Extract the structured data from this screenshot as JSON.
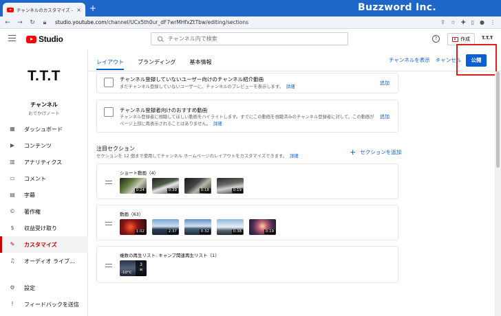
{
  "browser": {
    "tab_title": "チャンネルのカスタマイズ - YouTube S",
    "tab_close": "×",
    "new_tab": "+",
    "url_host": "studio.youtube.com",
    "url_path": "/channel/UCx5th0ur_dF7wrMHfxZtTbw/editing/sections",
    "brand_overlay": "Buzzword Inc."
  },
  "header": {
    "logo_text": "Studio",
    "search_placeholder": "チャンネル内で検索",
    "help_label": "?",
    "create_label": "作成",
    "avatar_label": "T.T.T"
  },
  "sidebar": {
    "channel_logo": "T.T.T",
    "channel_name": "チャンネル",
    "channel_sub": "おでかけノート",
    "items": [
      {
        "label": "ダッシュボード",
        "icon": "▦"
      },
      {
        "label": "コンテンツ",
        "icon": "▶"
      },
      {
        "label": "アナリティクス",
        "icon": "▥"
      },
      {
        "label": "コメント",
        "icon": "▭"
      },
      {
        "label": "字幕",
        "icon": "▤"
      },
      {
        "label": "著作権",
        "icon": "©"
      },
      {
        "label": "収益受け取り",
        "icon": "$"
      },
      {
        "label": "カスタマイズ",
        "icon": "✎"
      },
      {
        "label": "オーディオ ライブ...",
        "icon": "♫"
      }
    ],
    "bottom_items": [
      {
        "label": "設定",
        "icon": "⚙"
      },
      {
        "label": "フィードバックを送信",
        "icon": "!"
      }
    ]
  },
  "tabs": [
    {
      "label": "レイアウト"
    },
    {
      "label": "ブランディング"
    },
    {
      "label": "基本情報"
    }
  ],
  "actions": {
    "view_channel": "チャンネルを表示",
    "cancel": "キャンセル",
    "publish": "公開"
  },
  "cards": [
    {
      "title": "チャンネル登録していないユーザー向けのチャンネル紹介動画",
      "desc": "まだチャンネル登録していないユーザーに、チャンネルのプレビューを表示します。",
      "link": "詳細",
      "add": "追加"
    },
    {
      "title": "チャンネル登録者向けのおすすめ動画",
      "desc": "チャンネル登録者に視聴してほしい動画をハイライトします。すでにこの動画を視聴済みのチャンネル登録者に対して、この動画がページ上部に再表示されることはありません。",
      "link": "詳細",
      "add": "追加"
    }
  ],
  "featured": {
    "title": "注目セクション",
    "desc": "セクションを 12 個まで使用してチャンネル ホームページのレイアウトをカスタマイズできます。",
    "link": "詳細",
    "add_section": "セクションを追加"
  },
  "sections": [
    {
      "title": "ショート動画（4）",
      "thumbs": [
        "0:24",
        "0:39",
        "0:18",
        "0:19"
      ]
    },
    {
      "title": "動画（63）",
      "thumbs": [
        "1:02",
        "2:37",
        "0:32",
        "0:38",
        "0:19"
      ]
    },
    {
      "title": "複数の再生リスト: キャンプ関連再生リスト（1）",
      "playlist_count": "3",
      "playlist_temp": "-10°C"
    }
  ]
}
